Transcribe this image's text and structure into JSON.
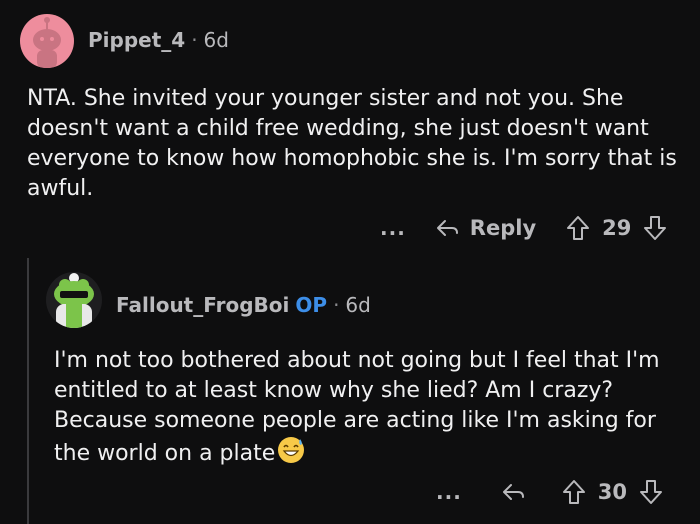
{
  "comment": {
    "username": "Pippet_4",
    "age": "6d",
    "text": "NTA. She invited your younger sister and not you. She doesn't want a child free wedding, she just doesn't want everyone to know how homophobic she is. I'm sorry that is awful.",
    "more_label": "...",
    "reply_label": "Reply",
    "votes": "29"
  },
  "reply": {
    "username": "Fallout_FrogBoi",
    "op_badge": "OP",
    "age": "6d",
    "text": "I'm not too bothered about not going but I feel that I'm entitled to at least know why she lied? Am I crazy? Because someone people are acting like I'm asking for the world on a plate",
    "emoji": "sweat-smile-emoji",
    "more_label": "...",
    "votes": "30"
  },
  "colors": {
    "background": "#0e0e0f",
    "text": "#f0f0f1",
    "meta": "#b9b9bc",
    "op_badge": "#3d8ee8",
    "avatar1": "#ee8d9d"
  }
}
